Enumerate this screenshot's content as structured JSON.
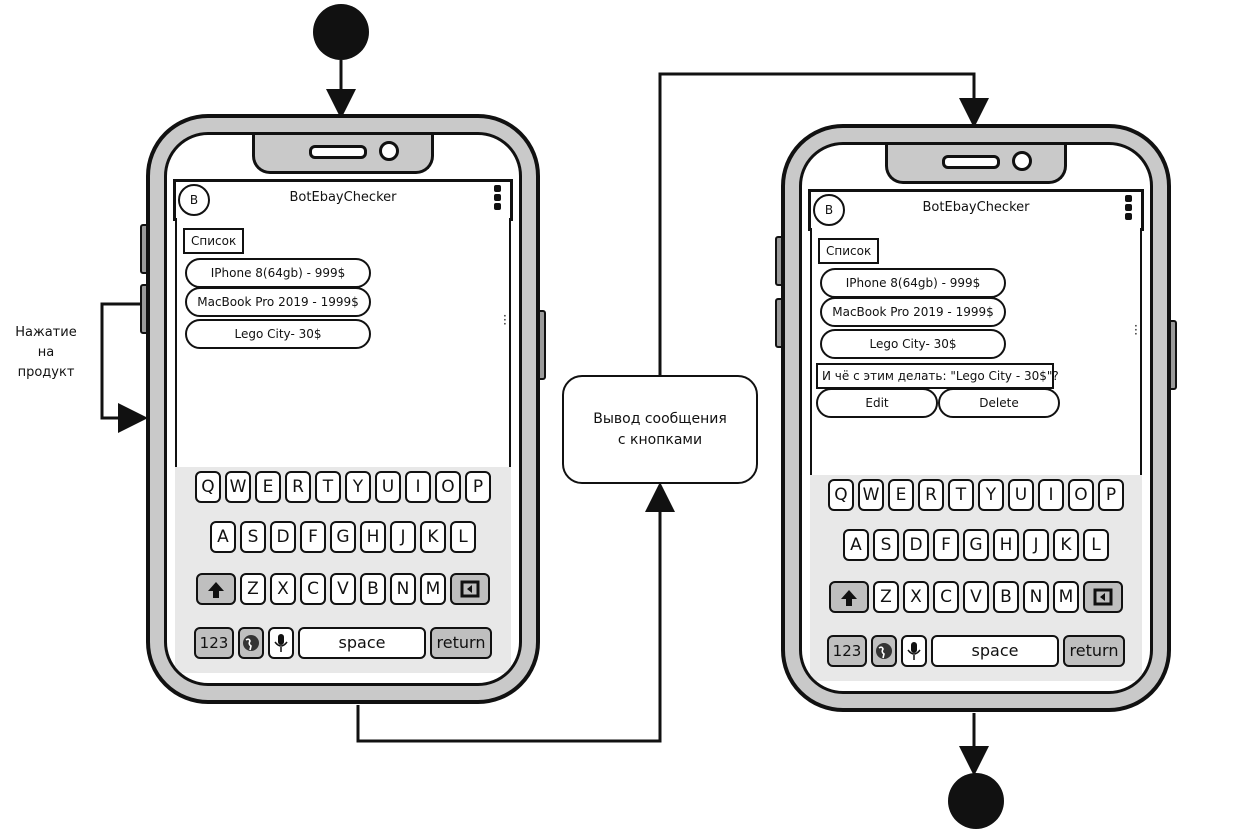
{
  "left_label": [
    "Нажатие",
    "на",
    "продукт"
  ],
  "center_label": [
    "Вывод сообщения",
    "с кнопками"
  ],
  "phones": [
    {
      "avatar": "B",
      "title": "BotEbayChecker",
      "list_label": "Список",
      "products": [
        "IPhone 8(64gb) - 999$",
        "MacBook Pro 2019 - 1999$",
        "Lego City- 30$"
      ],
      "question": "",
      "actions": []
    },
    {
      "avatar": "B",
      "title": "BotEbayChecker",
      "list_label": "Список",
      "products": [
        "IPhone 8(64gb) - 999$",
        "MacBook Pro 2019 - 1999$",
        "Lego City- 30$"
      ],
      "question": "И чё с этим делать: \"Lego City - 30$\"?",
      "actions": [
        "Edit",
        "Delete"
      ]
    }
  ],
  "keyboard": {
    "row1": [
      "Q",
      "W",
      "E",
      "R",
      "T",
      "Y",
      "U",
      "I",
      "O",
      "P"
    ],
    "row2": [
      "A",
      "S",
      "D",
      "F",
      "G",
      "H",
      "J",
      "K",
      "L"
    ],
    "row3": [
      "Z",
      "X",
      "C",
      "V",
      "B",
      "N",
      "M"
    ],
    "numbers": "123",
    "space": "space",
    "return": "return"
  },
  "icons": [
    "shift-arrow-icon",
    "backspace-icon",
    "globe-icon",
    "mic-icon",
    "kebab-menu-icon"
  ]
}
